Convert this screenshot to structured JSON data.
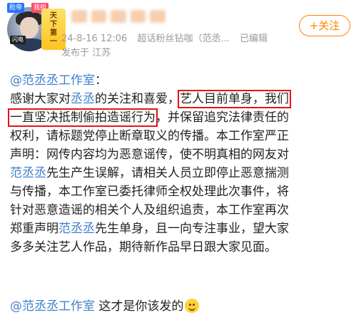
{
  "header": {
    "avatar_badge": [
      "天",
      "下",
      "第",
      "一"
    ],
    "tag_top_left": "脸帝",
    "tag_top_right": "我担",
    "mini_tag": "闪电",
    "meta": {
      "datetime": "24-8-16 12:06",
      "source": "超话粉丝钻咖（范丞...",
      "edited": "已编辑",
      "location_prefix": "发布于",
      "location": "江苏"
    },
    "follow_label": "+关注"
  },
  "post": {
    "mention": "@范丞丞工作室",
    "colon": "：",
    "lines": [
      {
        "pre": "感谢大家对",
        "link": "丞丞",
        "mid": "的关注和喜爱，",
        "hl": "艺人目前单身，我们"
      },
      {
        "hl": "一直坚决抵制偷拍造谣行为",
        "post": "，并保留追究法律责任的"
      },
      {
        "text": "权利，请标题党停止断章取义的传播。本工作室严正"
      },
      {
        "text": "声明：网传内容均为恶意谣传，使不明真相的网友对"
      },
      {
        "link": "范丞丞",
        "post": "先生产生误解，请相关人员立即停止恶意揣测"
      },
      {
        "text": "与传播，本工作室已委托律师全权处理此次事件，将"
      },
      {
        "text": "针对恶意造谣的相关个人及组织追责，本工作室再次"
      },
      {
        "pre": "郑重声明",
        "link": "范丞丞",
        "post": "先生单身，且一向专注事业，望大家"
      },
      {
        "text": "多多关注艺人作品，期待新作品早日跟大家见面。"
      }
    ]
  },
  "reply": {
    "mention": "@范丞丞工作室",
    "text": " 这才是你该发的"
  },
  "colors": {
    "link": "#3f7fce",
    "highlight_box": "#e8121a",
    "follow": "#ff8200",
    "meta": "#9a9a9a"
  }
}
